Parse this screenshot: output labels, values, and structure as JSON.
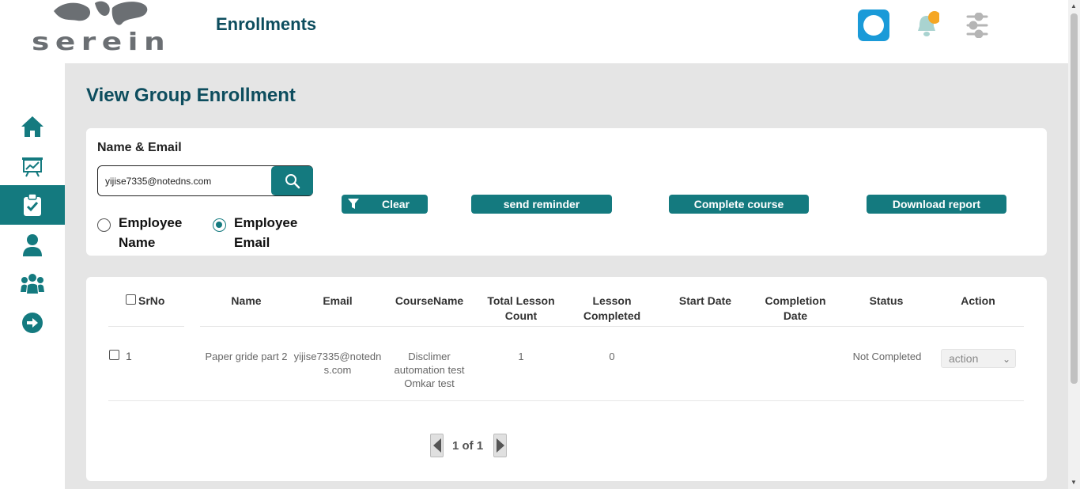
{
  "header": {
    "logo_text": "serein",
    "page_heading": "Enrollments"
  },
  "main": {
    "title": "View Group Enrollment",
    "filter": {
      "label": "Name & Email",
      "search_value": "yijise7335@notedns.com",
      "radio_name": "Employee Name",
      "radio_email": "Employee Email",
      "selected": "Employee Email"
    },
    "buttons": {
      "clear": "Clear",
      "send_reminder": "send reminder",
      "complete_course": "Complete course",
      "download_report": "Download report"
    },
    "table": {
      "headers": [
        "SrNo",
        "Name",
        "Email",
        "CourseName",
        "Total Lesson Count",
        "Lesson Completed",
        "Start Date",
        "Completion Date",
        "Status",
        "Action"
      ],
      "rows": [
        {
          "srno": "1",
          "name": "Paper gride part 2",
          "email": "yijise7335@notedns.com",
          "course": "Disclimer automation test Omkar test",
          "total_lessons": "1",
          "lessons_completed": "0",
          "start_date": "",
          "completion_date": "",
          "status": "Not Completed",
          "action": "action"
        }
      ]
    },
    "pagination": "1 of 1"
  },
  "colors": {
    "primary": "#147a7f",
    "heading": "#0d4d5e",
    "background": "#e5e5e5",
    "notification": "#f5a623"
  }
}
